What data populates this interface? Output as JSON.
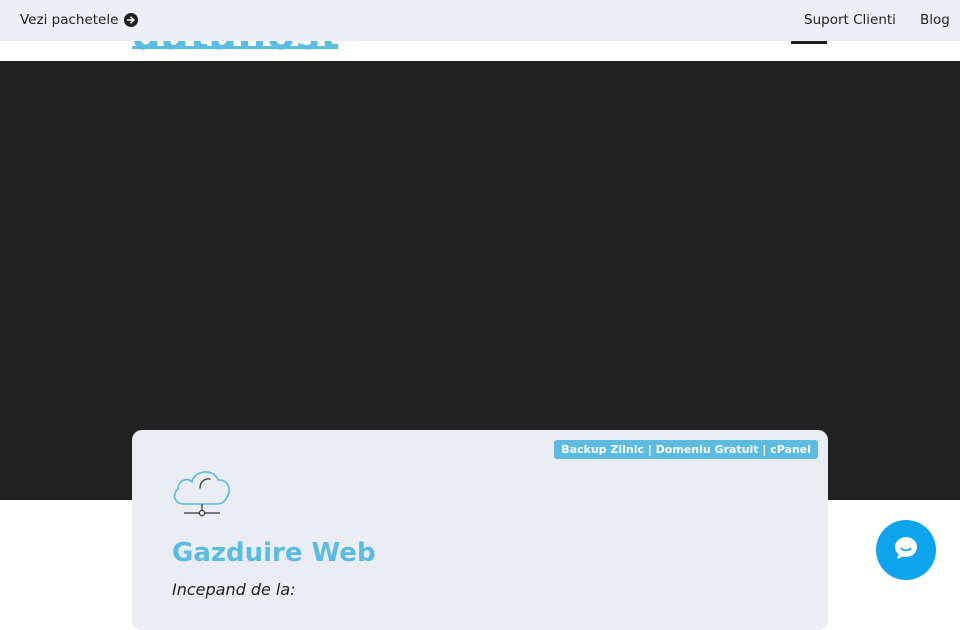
{
  "topbar": {
    "see_packages": "Vezi pachetele",
    "support": "Suport Clienti",
    "blog": "Blog"
  },
  "header": {
    "logo_text": "datahost"
  },
  "card": {
    "badge": "Backup Zilnic | Domeniu Gratuit | cPanel",
    "title": "Gazduire Web",
    "subtitle": "Incepand de la:"
  },
  "icons": {
    "see_packages": "arrow-right-circle-icon",
    "card": "cloud-server-icon",
    "chat": "chat-bubble-icon"
  },
  "colors": {
    "accent": "#5bbbe0",
    "chat": "#0ea5ee",
    "hero_bg": "#212121",
    "topbar_bg": "#eceff6"
  }
}
